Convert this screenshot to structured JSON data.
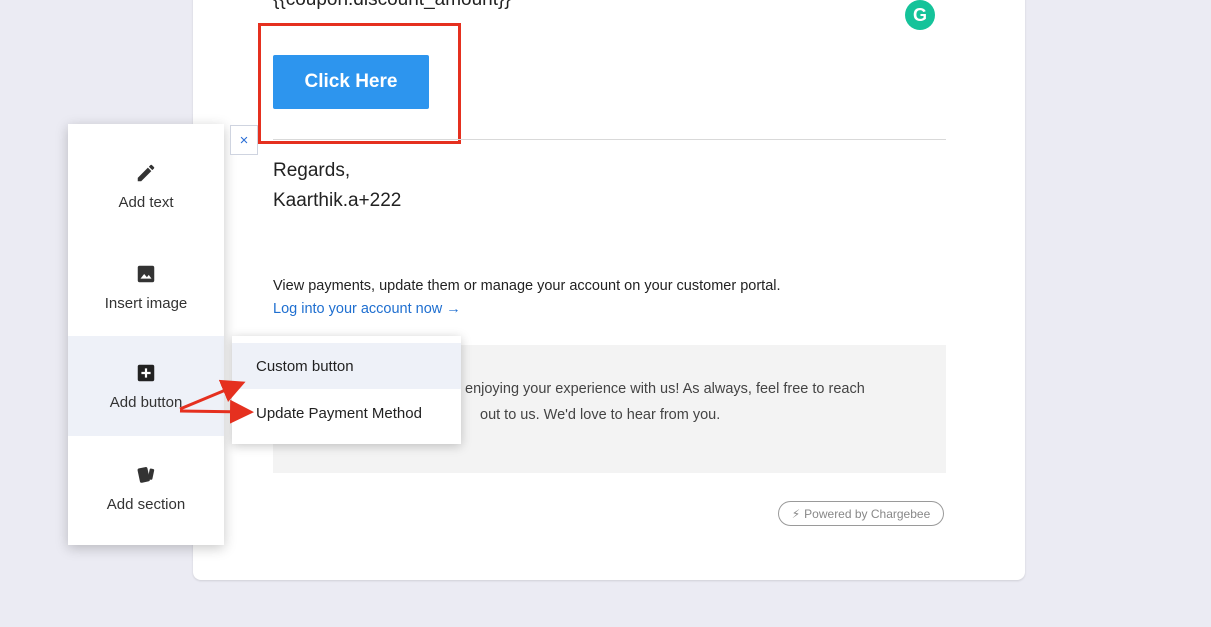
{
  "email": {
    "coupon_placeholder": "{{coupon.discount_amount}}",
    "cta_label": "Click Here",
    "regards_line1": "Regards,",
    "regards_line2": "Kaarthik.a+222",
    "portal_text": "View payments, update them or manage your account on your customer portal.",
    "portal_link": "Log into your account now →",
    "footer_line1": "enjoying your experience with us! As always, feel free to reach",
    "footer_line2": "out to us. We'd love to hear from you.",
    "powered_by": "Powered by Chargebee"
  },
  "grammarly": {
    "icon": "grammarly-icon",
    "color": "#15c39a"
  },
  "toolbar": {
    "close_label": "×",
    "items": [
      {
        "label": "Add text",
        "icon": "pencil-icon"
      },
      {
        "label": "Insert image",
        "icon": "image-icon"
      },
      {
        "label": "Add button",
        "icon": "plus-square-icon"
      },
      {
        "label": "Add section",
        "icon": "cards-icon"
      }
    ]
  },
  "add_button_menu": {
    "options": [
      "Custom button",
      "Update Payment Method"
    ]
  },
  "colors": {
    "accent": "#2d95ee",
    "highlight": "#e5301f",
    "link": "#1f6fd0",
    "background": "#ebebf3"
  }
}
